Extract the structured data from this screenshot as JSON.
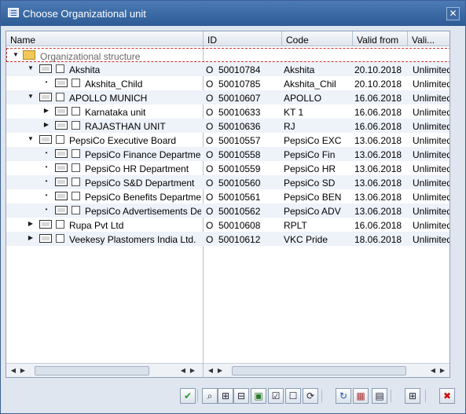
{
  "window": {
    "title": "Choose Organizational unit",
    "close_glyph": "✕"
  },
  "columns": [
    "Name",
    "ID",
    "Code",
    "Valid from",
    "Vali..."
  ],
  "root": {
    "label": "Organizational structure",
    "expand_glyph": "▼"
  },
  "rows": [
    {
      "name": "Akshita",
      "type": "O",
      "id": "50010784",
      "code": "Akshita",
      "valid_from": "20.10.2018",
      "valid_to": "Unlimited",
      "expand": "▼",
      "level": 1
    },
    {
      "name": "Akshita_Child",
      "type": "O",
      "id": "50010785",
      "code": "Akshita_Chil",
      "valid_from": "20.10.2018",
      "valid_to": "Unlimited",
      "expand": "•",
      "level": 2
    },
    {
      "name": "APOLLO MUNICH",
      "type": "O",
      "id": "50010607",
      "code": "APOLLO",
      "valid_from": "16.06.2018",
      "valid_to": "Unlimited",
      "expand": "▼",
      "level": 1
    },
    {
      "name": "Karnataka unit",
      "type": "O",
      "id": "50010633",
      "code": "KT 1",
      "valid_from": "16.06.2018",
      "valid_to": "Unlimited",
      "expand": "▶",
      "level": 2
    },
    {
      "name": "RAJASTHAN UNIT",
      "type": "O",
      "id": "50010636",
      "code": "RJ",
      "valid_from": "16.06.2018",
      "valid_to": "Unlimited",
      "expand": "▶",
      "level": 2
    },
    {
      "name": "PepsiCo Executive Board",
      "type": "O",
      "id": "50010557",
      "code": "PepsiCo EXC",
      "valid_from": "13.06.2018",
      "valid_to": "Unlimited",
      "expand": "▼",
      "level": 1
    },
    {
      "name": "PepsiCo Finance Departmen",
      "type": "O",
      "id": "50010558",
      "code": "PepsiCo Fin",
      "valid_from": "13.06.2018",
      "valid_to": "Unlimited",
      "expand": "•",
      "level": 2
    },
    {
      "name": "PepsiCo HR Department",
      "type": "O",
      "id": "50010559",
      "code": "PepsiCo HR",
      "valid_from": "13.06.2018",
      "valid_to": "Unlimited",
      "expand": "•",
      "level": 2
    },
    {
      "name": "PepsiCo S&D Department",
      "type": "O",
      "id": "50010560",
      "code": "PepsiCo SD",
      "valid_from": "13.06.2018",
      "valid_to": "Unlimited",
      "expand": "•",
      "level": 2
    },
    {
      "name": "PepsiCo Benefits Departme",
      "type": "O",
      "id": "50010561",
      "code": "PepsiCo BEN",
      "valid_from": "13.06.2018",
      "valid_to": "Unlimited",
      "expand": "•",
      "level": 2
    },
    {
      "name": "PepsiCo Advertisements De",
      "type": "O",
      "id": "50010562",
      "code": "PepsiCo ADV",
      "valid_from": "13.06.2018",
      "valid_to": "Unlimited",
      "expand": "•",
      "level": 2
    },
    {
      "name": "Rupa Pvt Ltd",
      "type": "O",
      "id": "50010608",
      "code": "RPLT",
      "valid_from": "16.06.2018",
      "valid_to": "Unlimited",
      "expand": "▶",
      "level": 1
    },
    {
      "name": "Veekesy Plastomers India Ltd.",
      "type": "O",
      "id": "50010612",
      "code": "VKC Pride",
      "valid_from": "18.06.2018",
      "valid_to": "Unlimited",
      "expand": "▶",
      "level": 1
    }
  ],
  "scroll_glyphs": {
    "left": "◀",
    "right": "▶"
  },
  "toolbar": [
    {
      "name": "confirm-button",
      "glyph": "✔",
      "color": "#2f9a2f"
    },
    {
      "name": "find-button",
      "glyph": "⌕",
      "color": "#222"
    },
    {
      "name": "expand-subtree-button",
      "glyph": "⊞",
      "color": "#223"
    },
    {
      "name": "collapse-subtree-button",
      "glyph": "⊟",
      "color": "#223"
    },
    {
      "name": "select-block-button",
      "glyph": "▣",
      "color": "#2a7a2a"
    },
    {
      "name": "select-all-button",
      "glyph": "☑",
      "color": "#223"
    },
    {
      "name": "deselect-all-button",
      "glyph": "☐",
      "color": "#223"
    },
    {
      "name": "find-next-button",
      "glyph": "⟳",
      "color": "#223"
    },
    {
      "name": "refresh-button",
      "glyph": "↻",
      "color": "#1d55a8"
    },
    {
      "name": "columns-button",
      "glyph": "▦",
      "color": "#a33"
    },
    {
      "name": "list-button",
      "glyph": "▤",
      "color": "#223"
    },
    {
      "name": "layout-button",
      "glyph": "⊞",
      "color": "#223"
    },
    {
      "name": "cancel-button",
      "glyph": "✖",
      "color": "#cc1111"
    }
  ]
}
